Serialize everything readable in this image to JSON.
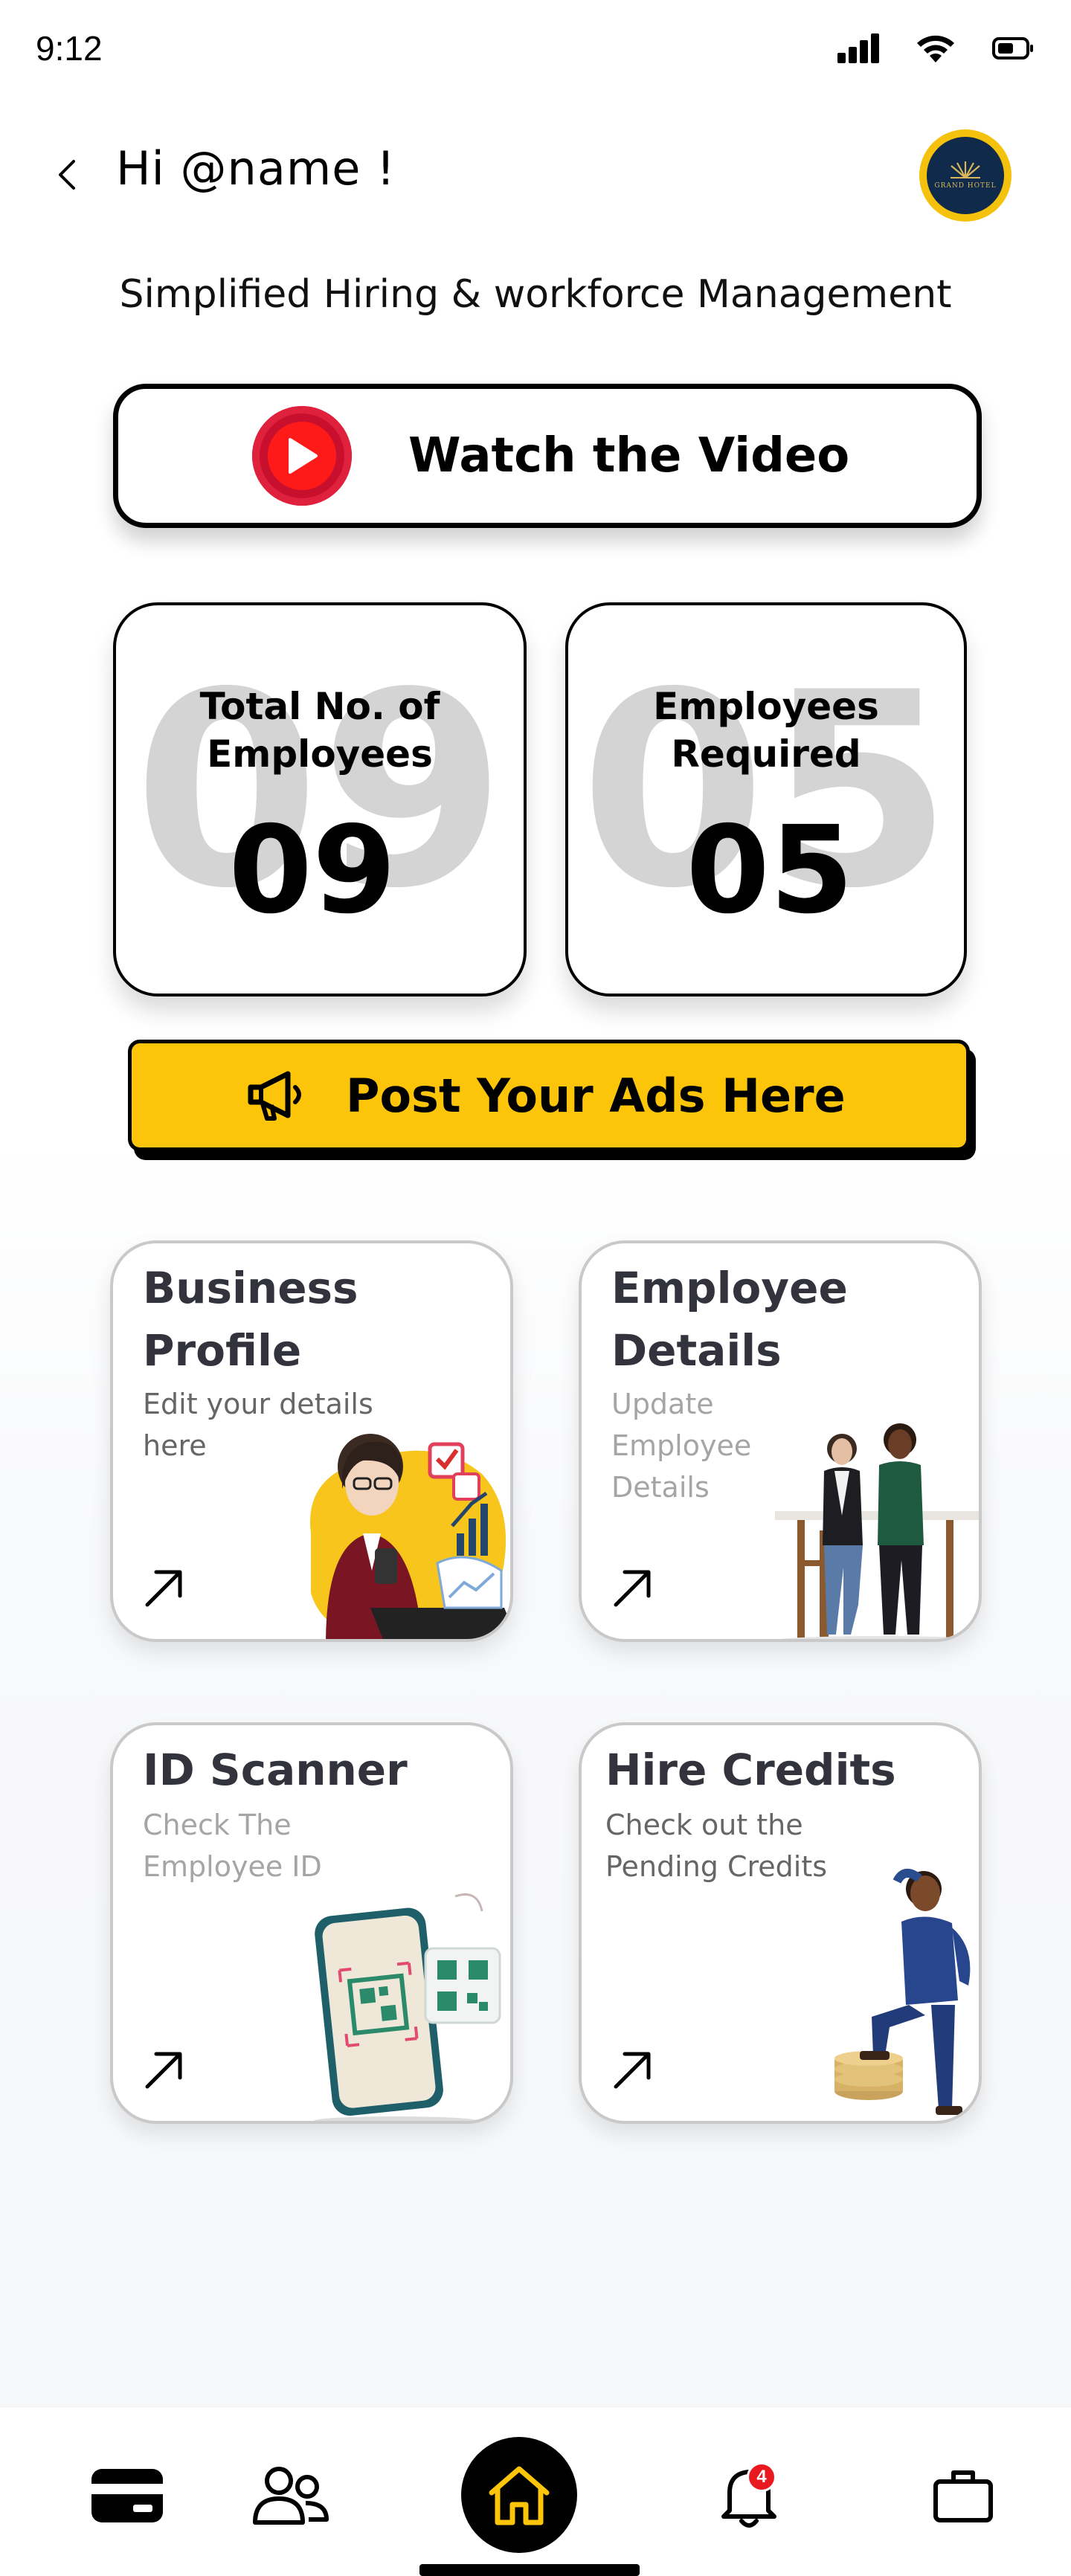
{
  "status_bar": {
    "time": "9:12"
  },
  "header": {
    "greeting": "Hi @name !",
    "avatar_label": "GRAND HOTEL"
  },
  "subtitle": "Simplified Hiring & workforce Management",
  "video_button": {
    "label": "Watch the Video"
  },
  "stats": [
    {
      "title_line1": "Total No. of",
      "title_line2": "Employees",
      "value": "09"
    },
    {
      "title_line1": "Employees",
      "title_line2": "Required",
      "value": "05"
    }
  ],
  "ads_button": {
    "label": "Post Your Ads Here"
  },
  "feature_cards": [
    {
      "title_line1": "Business",
      "title_line2": "Profile",
      "sub_line1": "Edit your details",
      "sub_line2": "here"
    },
    {
      "title_line1": "Employee",
      "title_line2": "Details",
      "sub_line1": "Update Employee",
      "sub_line2": "Details"
    },
    {
      "title_line1": "ID Scanner",
      "sub_line1": "Check The",
      "sub_line2": "Employee ID"
    },
    {
      "title_line1": "Hire Credits",
      "sub_line1": "Check out the",
      "sub_line2": "Pending Credits"
    }
  ],
  "bottom_nav": {
    "notification_count": "4",
    "items": [
      "card-icon",
      "users-icon",
      "home-icon",
      "bell-icon",
      "briefcase-icon"
    ]
  },
  "colors": {
    "accent_yellow": "#fcc509",
    "play_red": "#ff1a1a",
    "badge_red": "#e8191f",
    "avatar_navy": "#0f2a4a"
  }
}
